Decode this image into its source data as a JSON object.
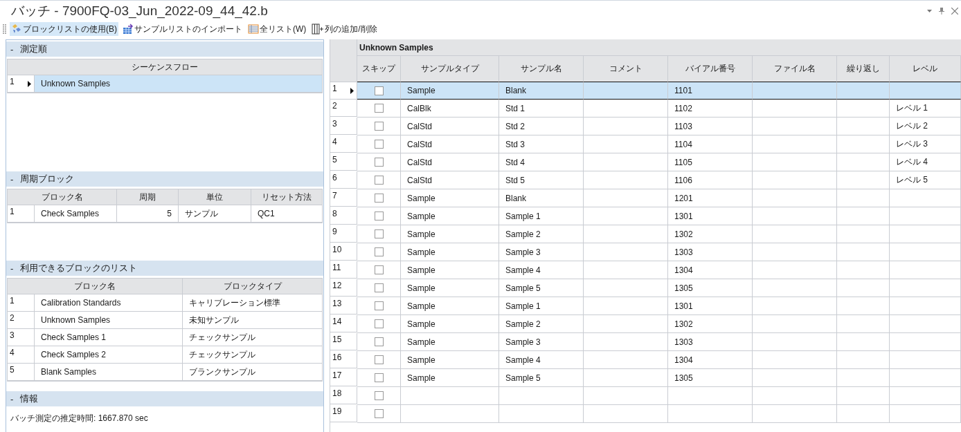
{
  "window": {
    "title": "バッチ - 7900FQ-03_Jun_2022-09_44_42.b"
  },
  "toolbar": [
    {
      "label": "ブロックリストの使用(B)",
      "selected": true
    },
    {
      "label": "サンプルリストのインポート",
      "selected": false
    },
    {
      "label": "全リスト(W)",
      "selected": false
    },
    {
      "label": "列の追加/削除",
      "selected": false
    }
  ],
  "sections": [
    {
      "kind": "table",
      "toggle": "-",
      "title": "測定順",
      "columns": [
        "シーケンスフロー"
      ],
      "rows": [
        {
          "num": "1",
          "selected": true,
          "cells": [
            "Unknown Samples"
          ]
        }
      ]
    },
    {
      "kind": "table",
      "toggle": "-",
      "title": "周期ブロック",
      "columns": [
        "ブロック名",
        "周期",
        "単位",
        "リセット方法"
      ],
      "rows": [
        {
          "num": "1",
          "selected": false,
          "cells": [
            "Check Samples",
            "5",
            "サンプル",
            "QC1"
          ]
        }
      ]
    },
    {
      "kind": "table",
      "toggle": "-",
      "title": "利用できるブロックのリスト",
      "columns": [
        "ブロック名",
        "ブロックタイプ"
      ],
      "rows": [
        {
          "num": "1",
          "selected": false,
          "cells": [
            "Calibration Standards",
            "キャリブレーション標準"
          ]
        },
        {
          "num": "2",
          "selected": false,
          "cells": [
            "Unknown Samples",
            "未知サンプル"
          ]
        },
        {
          "num": "3",
          "selected": false,
          "cells": [
            "Check Samples 1",
            "チェックサンプル"
          ]
        },
        {
          "num": "4",
          "selected": false,
          "cells": [
            "Check Samples 2",
            "チェックサンプル"
          ]
        },
        {
          "num": "5",
          "selected": false,
          "cells": [
            "Blank Samples",
            "ブランクサンプル"
          ]
        }
      ]
    },
    {
      "kind": "info",
      "toggle": "-",
      "title": "情報",
      "text": "バッチ測定の推定時間: 1667.870 sec"
    }
  ],
  "grid": {
    "group": "Unknown Samples",
    "columns": [
      "スキップ",
      "サンプルタイプ",
      "サンプル名",
      "コメント",
      "バイアル番号",
      "ファイル名",
      "繰り返し",
      "レベル"
    ],
    "rows": [
      {
        "num": "1",
        "selected": true,
        "skip": false,
        "type": "Sample",
        "name": "Blank",
        "vial": "1101"
      },
      {
        "num": "2",
        "selected": false,
        "skip": false,
        "type": "CalBlk",
        "name": "Std 1",
        "vial": "1102",
        "level": "レベル 1"
      },
      {
        "num": "3",
        "selected": false,
        "skip": false,
        "type": "CalStd",
        "name": "Std 2",
        "vial": "1103",
        "level": "レベル 2"
      },
      {
        "num": "4",
        "selected": false,
        "skip": false,
        "type": "CalStd",
        "name": "Std 3",
        "vial": "1104",
        "level": "レベル 3"
      },
      {
        "num": "5",
        "selected": false,
        "skip": false,
        "type": "CalStd",
        "name": "Std 4",
        "vial": "1105",
        "level": "レベル 4"
      },
      {
        "num": "6",
        "selected": false,
        "skip": false,
        "type": "CalStd",
        "name": "Std 5",
        "vial": "1106",
        "level": "レベル 5"
      },
      {
        "num": "7",
        "selected": false,
        "skip": false,
        "type": "Sample",
        "name": "Blank",
        "vial": "1201"
      },
      {
        "num": "8",
        "selected": false,
        "skip": false,
        "type": "Sample",
        "name": "Sample 1",
        "vial": "1301"
      },
      {
        "num": "9",
        "selected": false,
        "skip": false,
        "type": "Sample",
        "name": "Sample 2",
        "vial": "1302"
      },
      {
        "num": "10",
        "selected": false,
        "skip": false,
        "type": "Sample",
        "name": "Sample 3",
        "vial": "1303"
      },
      {
        "num": "11",
        "selected": false,
        "skip": false,
        "type": "Sample",
        "name": "Sample 4",
        "vial": "1304"
      },
      {
        "num": "12",
        "selected": false,
        "skip": false,
        "type": "Sample",
        "name": "Sample 5",
        "vial": "1305"
      },
      {
        "num": "13",
        "selected": false,
        "skip": false,
        "type": "Sample",
        "name": "Sample 1",
        "vial": "1301"
      },
      {
        "num": "14",
        "selected": false,
        "skip": false,
        "type": "Sample",
        "name": "Sample 2",
        "vial": "1302"
      },
      {
        "num": "15",
        "selected": false,
        "skip": false,
        "type": "Sample",
        "name": "Sample 3",
        "vial": "1303"
      },
      {
        "num": "16",
        "selected": false,
        "skip": false,
        "type": "Sample",
        "name": "Sample 4",
        "vial": "1304"
      },
      {
        "num": "17",
        "selected": false,
        "skip": false,
        "type": "Sample",
        "name": "Sample 5",
        "vial": "1305"
      },
      {
        "num": "18",
        "selected": false,
        "skip": false
      },
      {
        "num": "19",
        "selected": false,
        "skip": false
      }
    ]
  }
}
